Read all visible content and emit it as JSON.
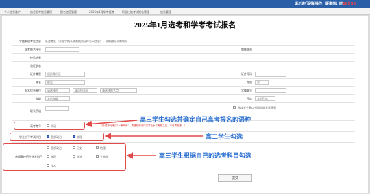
{
  "topbar": {
    "notice": "请勿进行刷新操作，距离倒计时",
    "timer": "16分36"
  },
  "nav": {
    "items": [
      "个人信息维护",
      "信息报考信息管理",
      "报名信息管理",
      "2025年1月学考报考",
      "职业技能考试报名管理",
      "信息管理"
    ]
  },
  "page_title": "2025年1月选考和学考考试报名",
  "form": {
    "labels": {
      "student_type": "学籍系统考生信息",
      "exam_no": "学考报名序号",
      "cert_result": "校验结果",
      "cert_status": "验证状态",
      "id_type": "证件类型",
      "id_no": "证件号码",
      "name": "姓名",
      "gender": "性别",
      "region": "报名信息单位",
      "school_no": "学籍编号",
      "grade": "年级",
      "ethnic": "民族",
      "phone": "联系手机",
      "gaokao": "高考考号",
      "xuekao": "学业水平考试科目",
      "xuankao": "普通高校招生选考科目",
      "audit_status": "审核状态"
    },
    "values": {
      "student_type": "社会考生（未在学籍系统查找到证件号码信息），学籍编号不需填写",
      "id_type": "居民身份证",
      "name": "张三",
      "gender": "男",
      "region_city": "请选择市",
      "region_district": "请选择县区",
      "region_point": "请选择报名点",
      "grade": "其他年级",
      "ethnic": "其他民族",
      "waste_notice": "残疾考生需以书面申请考试便利",
      "gaokao_option": "外语",
      "gaokao_note": "（外语单元考试“一考两用”，须通知用于评定学业水平考核之后，不可再报考。）",
      "xuekao_options": [
        "思想政治",
        "物理"
      ],
      "xuankao_options": [
        "思想政治",
        "历史",
        "地理",
        "物理",
        "化学",
        "生物学",
        "技术"
      ]
    }
  },
  "annotations": {
    "a1": "高三学生勾选并确定自己高考报名的语种",
    "a2": "高二学生勾选",
    "a3": "高三学生根据自己的选考科目勾选"
  },
  "submit_label": "提交",
  "colors": {
    "topbar": "#2a5fa8",
    "annotation": "#2a6fd0",
    "highlight": "#e24a4a",
    "accent_rule": "#3b63b5"
  }
}
